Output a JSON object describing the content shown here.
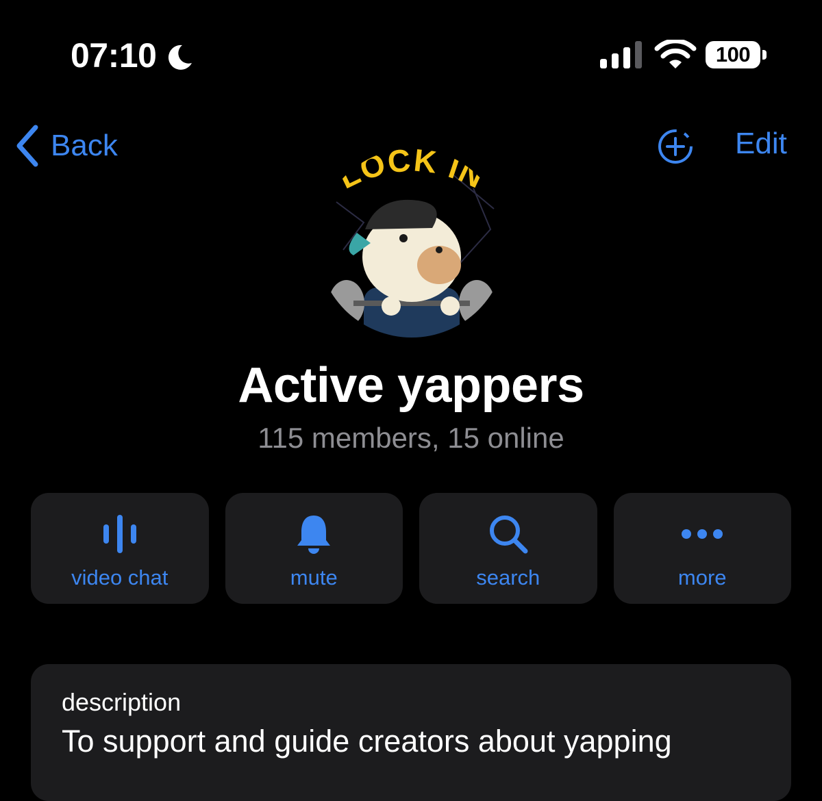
{
  "status_bar": {
    "time": "07:10",
    "focus_icon": "moon-icon",
    "signal_icon": "cellular-signal-icon",
    "wifi_icon": "wifi-icon",
    "battery": "100"
  },
  "nav": {
    "back_label": "Back",
    "add_icon": "add-story-icon",
    "edit_label": "Edit"
  },
  "group": {
    "avatar_text": "LOCK IN",
    "name": "Active yappers",
    "subtitle": "115 members, 15 online"
  },
  "actions": [
    {
      "label": "video chat",
      "icon": "voice-chat-icon"
    },
    {
      "label": "mute",
      "icon": "bell-icon"
    },
    {
      "label": "search",
      "icon": "search-icon"
    },
    {
      "label": "more",
      "icon": "ellipsis-icon"
    }
  ],
  "description": {
    "label": "description",
    "text": "To support and guide creators about yapping"
  },
  "colors": {
    "accent": "#3d86f0",
    "card": "#1c1c1e",
    "secondary_text": "#8e8e93",
    "background": "#000000"
  }
}
